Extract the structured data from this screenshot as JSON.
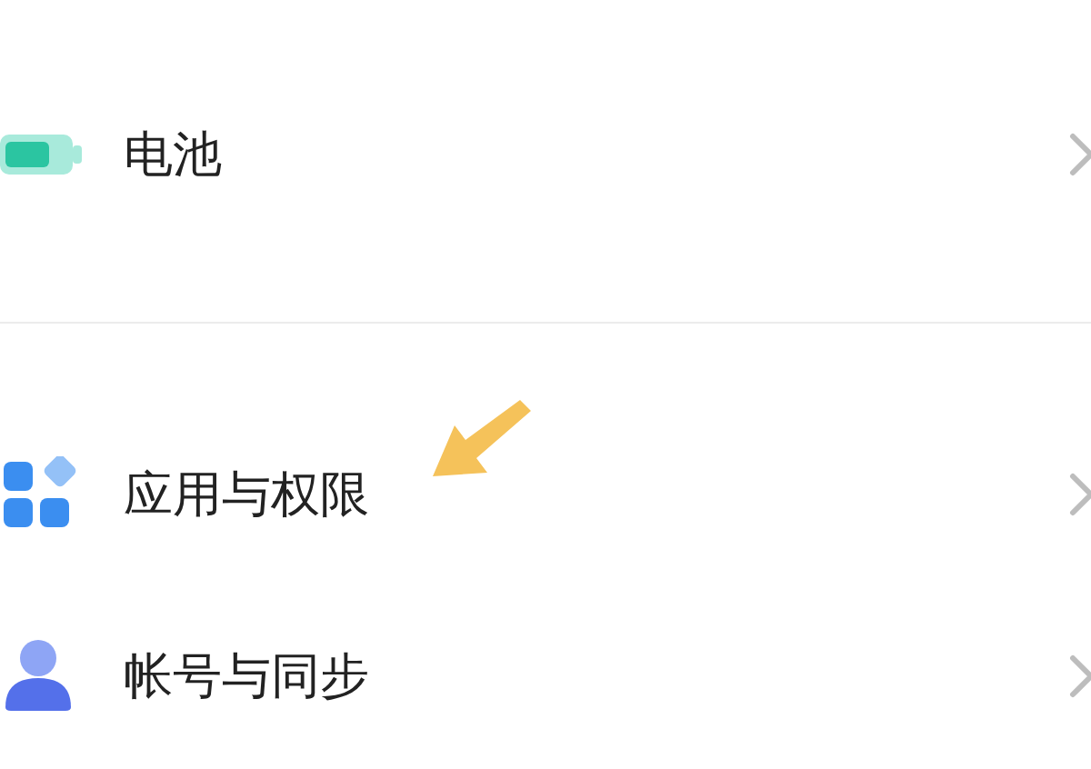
{
  "groups": [
    {
      "items": [
        {
          "kind": "battery",
          "label": "电池"
        }
      ]
    },
    {
      "items": [
        {
          "kind": "apps",
          "label": "应用与权限"
        },
        {
          "kind": "account",
          "label": "帐号与同步"
        }
      ]
    }
  ],
  "annotation": {
    "kind": "arrow",
    "color": "#f5c25a"
  }
}
